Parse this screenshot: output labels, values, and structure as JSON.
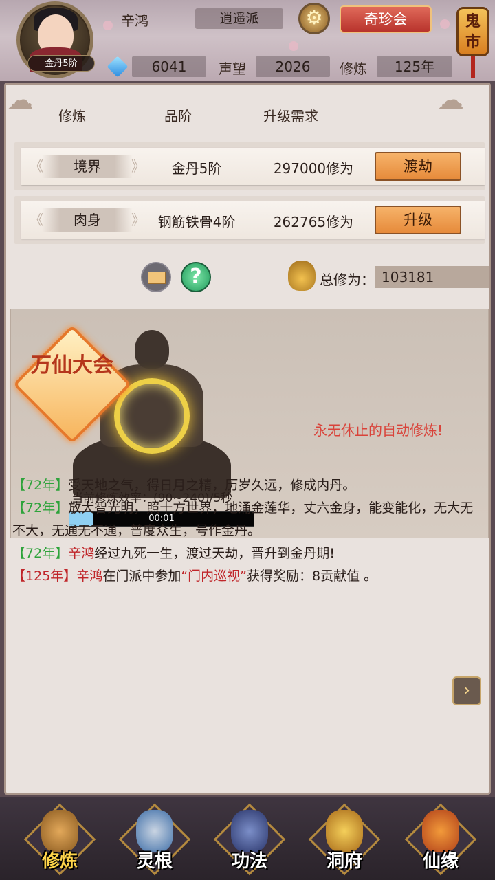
{
  "header": {
    "player_name": "辛鸿",
    "rank_badge": "金丹5阶",
    "sect": "逍遥派",
    "treasure_button": "奇珍会",
    "ghost_market": "鬼市",
    "gems": "6041",
    "reputation_label": "声望",
    "reputation": "2026",
    "cultivation_label": "修炼",
    "cultivation_years": "125年"
  },
  "table": {
    "headers": [
      "修炼",
      "品阶",
      "升级需求"
    ],
    "rows": [
      {
        "name": "境界",
        "grade": "金丹5阶",
        "requirement": "297000修为",
        "action": "渡劫"
      },
      {
        "name": "肉身",
        "grade": "钢筋铁骨4阶",
        "requirement": "262765修为",
        "action": "升级"
      }
    ]
  },
  "total": {
    "label": "总修为：",
    "value": "103181"
  },
  "cultivation": {
    "event_badge": "万仙大会",
    "auto_text": "永无休止的自动修炼!",
    "rate_text": "当前修炼效率：(90~240)/5秒",
    "progress_time": "00:01",
    "progress_fraction": 0.13
  },
  "log": [
    {
      "year": "72年",
      "text": "受天地之气，得日月之精，历岁久远，修成内丹。"
    },
    {
      "year": "72年",
      "text": "放大智光明，照十方世界，地涌金莲华，丈六金身，能变能化，无大无不大，无通无不通，普度众生，号作金丹。"
    },
    {
      "year": "72年",
      "name": "辛鸿",
      "text": "经过九死一生，渡过天劫，晋升到金丹期!"
    },
    {
      "year": "125年",
      "name": "辛鸿",
      "pre": "在门派中参加",
      "quote": "“门内巡视”",
      "post": "获得奖励：8贡献值 。"
    }
  ],
  "nav": [
    {
      "label": "修炼",
      "active": true
    },
    {
      "label": "灵根"
    },
    {
      "label": "功法"
    },
    {
      "label": "洞府"
    },
    {
      "label": "仙缘"
    }
  ],
  "colors": {
    "accent_orange": "#e68a3a",
    "log_green": "#2ea33b",
    "log_red": "#c0262a",
    "auto_text_red": "#d9433a",
    "progress_blue": "#8fd0f2"
  }
}
